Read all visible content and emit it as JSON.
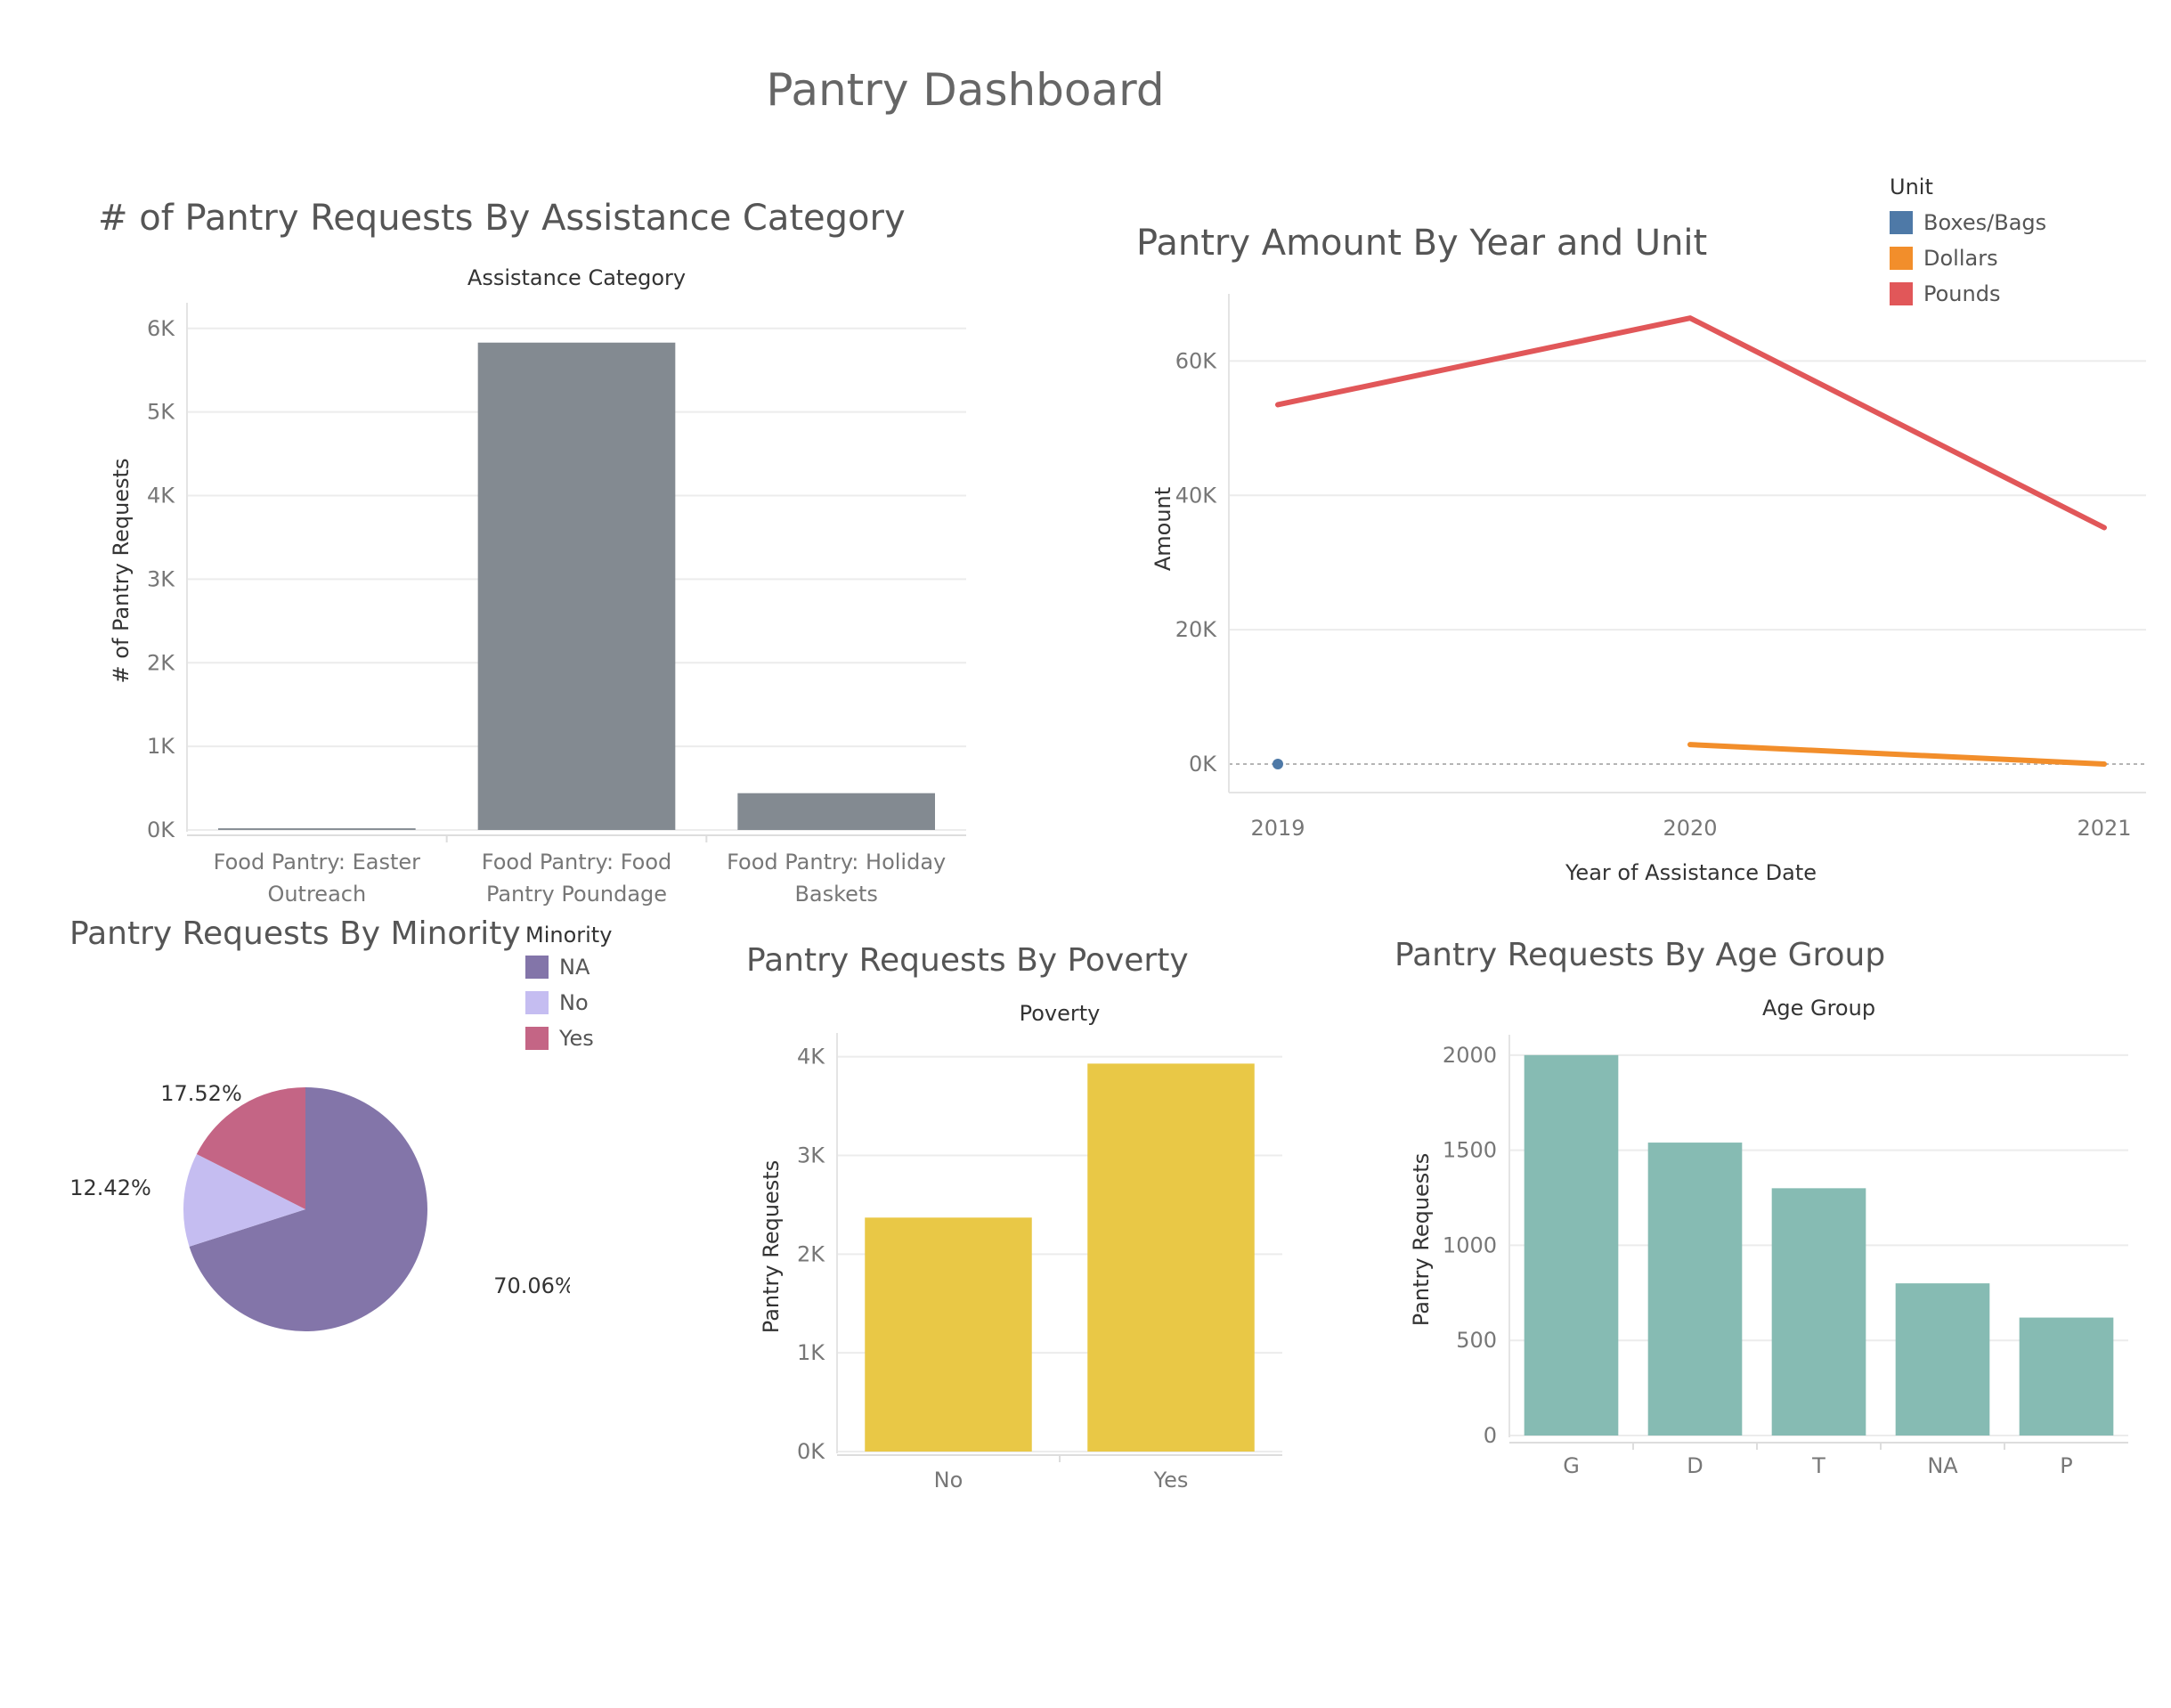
{
  "dashboard": {
    "title": "Pantry Dashboard"
  },
  "charts": {
    "assistance": {
      "title": "# of Pantry Requests By Assistance Category",
      "header": "Assistance Category",
      "ylabel": "# of Pantry Requests"
    },
    "amount": {
      "title": "Pantry Amount By Year and Unit",
      "legend_title": "Unit",
      "xlabel": "Year of Assistance Date",
      "ylabel": "Amount"
    },
    "minority": {
      "title": "Pantry Requests By Minority",
      "legend_title": "Minority"
    },
    "poverty": {
      "title": "Pantry Requests By Poverty",
      "header": "Poverty",
      "ylabel": "Pantry Requests"
    },
    "age": {
      "title": "Pantry Requests By Age Group",
      "header": "Age Group",
      "ylabel": "Pantry Requests"
    }
  },
  "chart_data": [
    {
      "id": "assistance",
      "type": "bar",
      "title": "# of Pantry Requests By Assistance Category",
      "header": "Assistance Category",
      "ylabel": "# of Pantry Requests",
      "categories": [
        [
          "Food Pantry: Easter",
          "Outreach"
        ],
        [
          "Food Pantry: Food",
          "Pantry Poundage"
        ],
        [
          "Food Pantry: Holiday",
          "Baskets"
        ]
      ],
      "values": [
        20,
        5830,
        440
      ],
      "ylim": [
        0,
        6200
      ],
      "yticks": [
        {
          "v": 0,
          "label": "0K"
        },
        {
          "v": 1000,
          "label": "1K"
        },
        {
          "v": 2000,
          "label": "2K"
        },
        {
          "v": 3000,
          "label": "3K"
        },
        {
          "v": 4000,
          "label": "4K"
        },
        {
          "v": 5000,
          "label": "5K"
        },
        {
          "v": 6000,
          "label": "6K"
        }
      ],
      "color": "#838a91",
      "grid": true
    },
    {
      "id": "amount",
      "type": "line",
      "title": "Pantry Amount By Year and Unit",
      "xlabel": "Year of Assistance Date",
      "ylabel": "Amount",
      "x": [
        2019,
        2020,
        2021
      ],
      "xticks": [
        "2019",
        "2020",
        "2021"
      ],
      "series": [
        {
          "name": "Boxes/Bags",
          "color": "#4e79a7",
          "values": [
            0,
            null,
            null
          ]
        },
        {
          "name": "Dollars",
          "color": "#f28e2b",
          "values": [
            null,
            2900,
            0
          ]
        },
        {
          "name": "Pounds",
          "color": "#e15759",
          "values": [
            53500,
            66400,
            35200
          ]
        }
      ],
      "ylim": [
        0,
        70000
      ],
      "yticks": [
        {
          "v": 0,
          "label": "0K"
        },
        {
          "v": 20000,
          "label": "20K"
        },
        {
          "v": 40000,
          "label": "40K"
        },
        {
          "v": 60000,
          "label": "60K"
        }
      ],
      "legend_title": "Unit",
      "legend": "top-right",
      "grid": true
    },
    {
      "id": "minority",
      "type": "pie",
      "title": "Pantry Requests By Minority",
      "legend_title": "Minority",
      "slices": [
        {
          "name": "NA",
          "value": 70.06,
          "label": "70.06%",
          "color": "#8375a9"
        },
        {
          "name": "No",
          "value": 12.42,
          "label": "12.42%",
          "color": "#c5bdf1"
        },
        {
          "name": "Yes",
          "value": 17.52,
          "label": "17.52%",
          "color": "#c46585"
        }
      ],
      "legend": "top-right"
    },
    {
      "id": "poverty",
      "type": "bar",
      "title": "Pantry Requests By Poverty",
      "header": "Poverty",
      "ylabel": "Pantry Requests",
      "categories": [
        [
          "No"
        ],
        [
          "Yes"
        ]
      ],
      "values": [
        2370,
        3930
      ],
      "ylim": [
        0,
        4150
      ],
      "yticks": [
        {
          "v": 0,
          "label": "0K"
        },
        {
          "v": 1000,
          "label": "1K"
        },
        {
          "v": 2000,
          "label": "2K"
        },
        {
          "v": 3000,
          "label": "3K"
        },
        {
          "v": 4000,
          "label": "4K"
        }
      ],
      "color": "#e9c846",
      "grid": true
    },
    {
      "id": "age",
      "type": "bar",
      "title": "Pantry Requests By Age Group",
      "header": "Age Group",
      "ylabel": "Pantry Requests",
      "categories": [
        [
          "G"
        ],
        [
          "D"
        ],
        [
          "T"
        ],
        [
          "NA"
        ],
        [
          "P"
        ]
      ],
      "values": [
        2000,
        1540,
        1300,
        800,
        620
      ],
      "ylim": [
        0,
        2060
      ],
      "yticks": [
        {
          "v": 0,
          "label": "0"
        },
        {
          "v": 500,
          "label": "500"
        },
        {
          "v": 1000,
          "label": "1000"
        },
        {
          "v": 1500,
          "label": "1500"
        },
        {
          "v": 2000,
          "label": "2000"
        }
      ],
      "color": "#86bbb3",
      "grid": true
    }
  ]
}
